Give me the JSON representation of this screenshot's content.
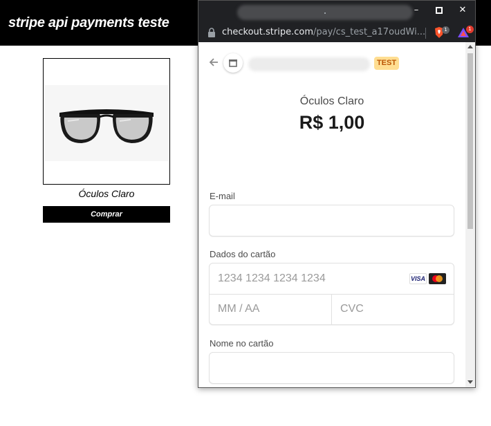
{
  "site": {
    "title": "stripe api payments teste",
    "product": {
      "name": "Óculos Claro",
      "buy_label": "Comprar"
    }
  },
  "browser": {
    "url_host": "checkout.stripe.com",
    "url_path": "/pay/cs_test_a17oudWi...",
    "brave_badge": "1",
    "rewards_badge": "1",
    "window_controls": {
      "minimize": "–",
      "maximize": "□",
      "close": "✕"
    }
  },
  "checkout": {
    "test_badge": "TEST",
    "product_name": "Óculos Claro",
    "price": "R$ 1,00",
    "email_label": "E-mail",
    "card_label": "Dados do cartão",
    "card_number_placeholder": "1234 1234 1234 1234",
    "expiry_placeholder": "MM / AA",
    "cvc_placeholder": "CVC",
    "visa_label": "VISA",
    "name_label": "Nome no cartão"
  },
  "colors": {
    "test_badge_bg": "#ffde92",
    "test_badge_text": "#bb5504",
    "header_bg": "#000000"
  }
}
